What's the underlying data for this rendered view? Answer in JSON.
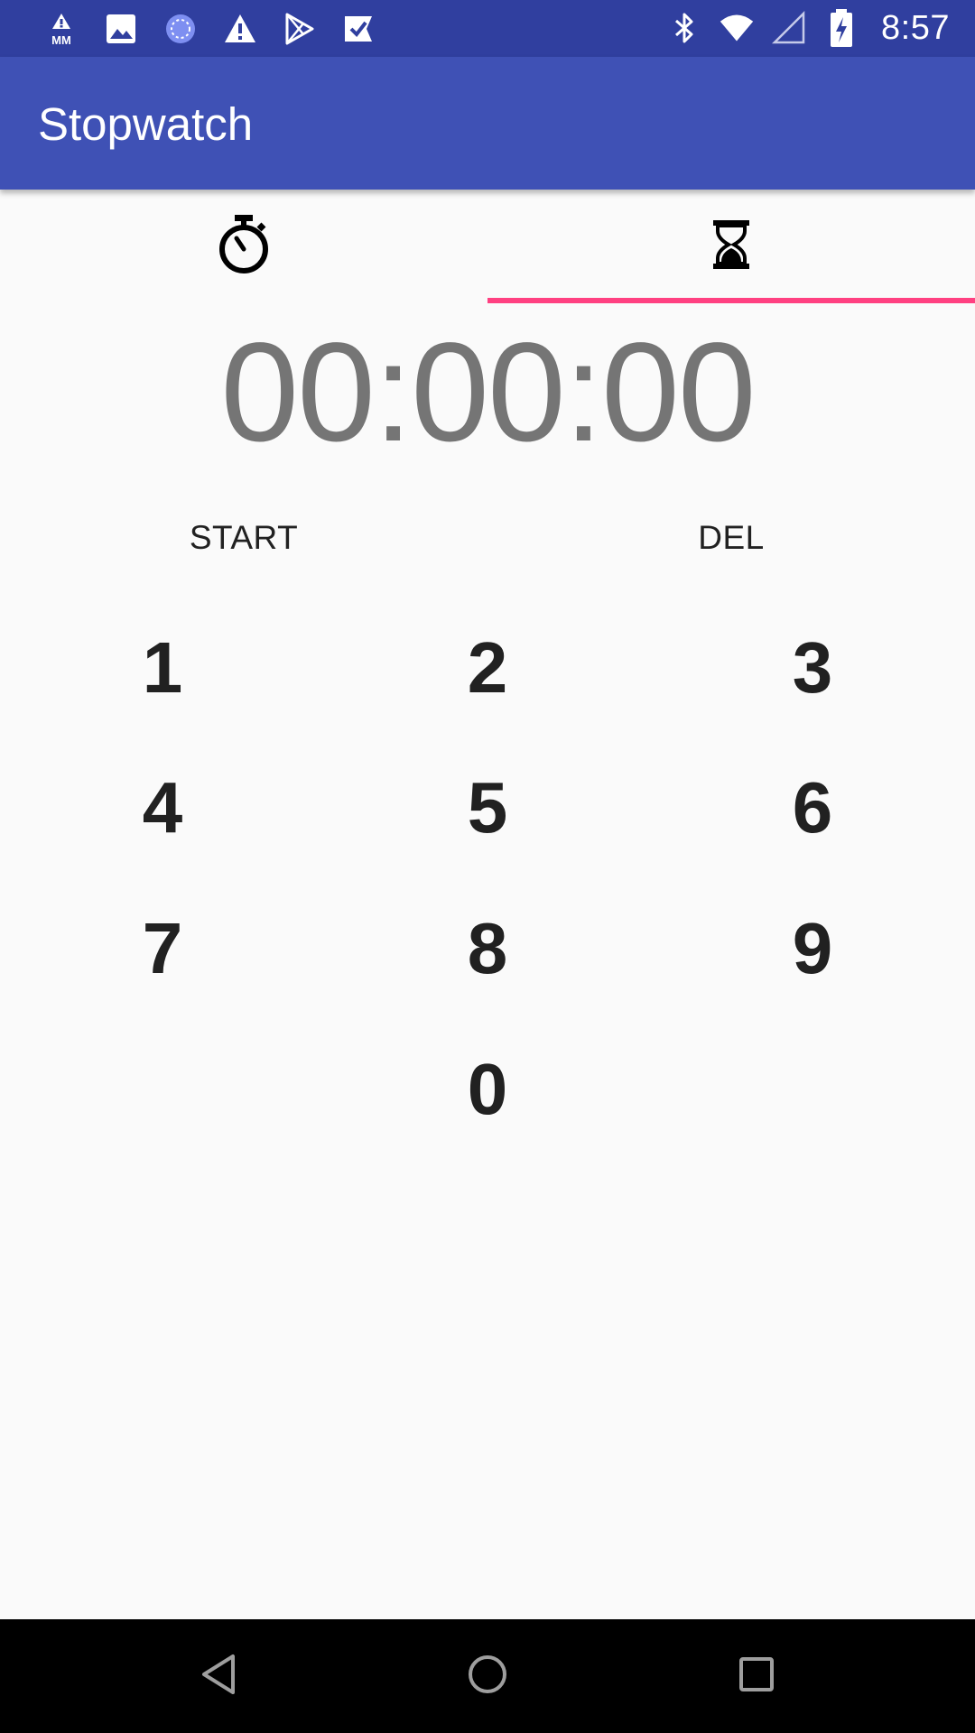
{
  "status_bar": {
    "left_icons": [
      "mm-warning-icon",
      "image-icon",
      "sync-circle-icon",
      "warning-icon",
      "play-store-icon",
      "check-flag-icon"
    ],
    "right_icons": [
      "bluetooth-icon",
      "wifi-icon",
      "signal-icon",
      "battery-charging-icon"
    ],
    "time": "8:57",
    "background": "#303F9F"
  },
  "app_bar": {
    "title": "Stopwatch",
    "background": "#3F51B5"
  },
  "tabs": {
    "items": [
      {
        "icon": "stopwatch-icon",
        "selected": false
      },
      {
        "icon": "hourglass-icon",
        "selected": true
      }
    ],
    "indicator_color": "#FF4081"
  },
  "timer": {
    "display": "00:00:00"
  },
  "actions": {
    "start_label": "START",
    "del_label": "DEL"
  },
  "keypad": {
    "keys": [
      "1",
      "2",
      "3",
      "4",
      "5",
      "6",
      "7",
      "8",
      "9",
      "0"
    ]
  },
  "nav_bar": {
    "buttons": [
      "back-icon",
      "home-icon",
      "recents-icon"
    ]
  }
}
